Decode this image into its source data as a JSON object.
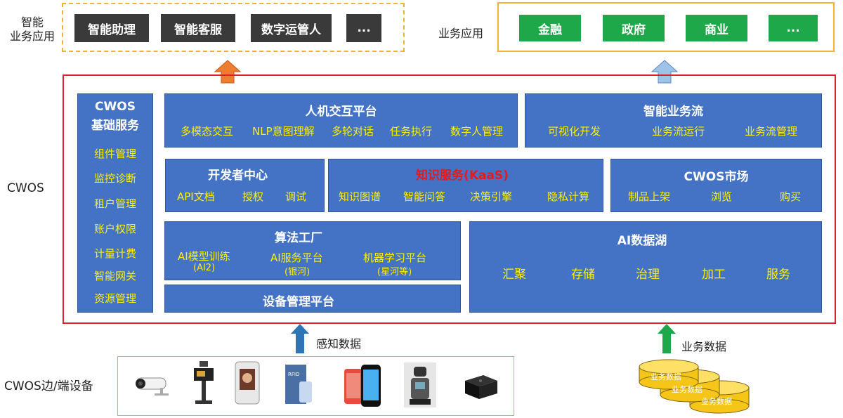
{
  "top_left": {
    "label_line1": "智能",
    "label_line2": "业务应用",
    "buttons": [
      "智能助理",
      "智能客服",
      "数字运管人",
      "..."
    ]
  },
  "top_right": {
    "label": "业务应用",
    "buttons": [
      "金融",
      "政府",
      "商业",
      "..."
    ]
  },
  "left_labels": {
    "cwos": "CWOS",
    "edge": "CWOS边/端设备"
  },
  "base_services": {
    "title_line1": "CWOS",
    "title_line2": "基础服务",
    "items": [
      "组件管理",
      "监控诊断",
      "租户管理",
      "账户权限",
      "计量计费",
      "智能网关",
      "资源管理"
    ]
  },
  "hci": {
    "title": "人机交互平台",
    "items": [
      "多模态交互",
      "NLP意图理解",
      "多轮对话",
      "任务执行",
      "数字人管理"
    ]
  },
  "workflow": {
    "title": "智能业务流",
    "items": [
      "可视化开发",
      "业务流运行",
      "业务流管理"
    ]
  },
  "dev_center": {
    "title": "开发者中心",
    "items": [
      "API文档",
      "授权",
      "调试"
    ]
  },
  "kaas": {
    "title": "知识服务(KaaS)",
    "items": [
      "知识图谱",
      "智能问答",
      "决策引擎",
      "隐私计算"
    ]
  },
  "market": {
    "title": "CWOS市场",
    "items": [
      "制品上架",
      "浏览",
      "购买"
    ]
  },
  "algo": {
    "title": "算法工厂",
    "items": [
      {
        "name": "AI模型训练",
        "sub": "(AI2)"
      },
      {
        "name": "AI服务平台",
        "sub": "(银河)"
      },
      {
        "name": "机器学习平台",
        "sub": "(星河等)"
      }
    ]
  },
  "device_mgmt": {
    "title": "设备管理平台"
  },
  "datalake": {
    "title": "AI数据湖",
    "items": [
      "汇聚",
      "存储",
      "治理",
      "加工",
      "服务"
    ]
  },
  "arrows": {
    "sensing": "感知数据",
    "business": "业务数据"
  },
  "db_labels": [
    "业务数据",
    "业务数据",
    "业务数据"
  ],
  "device_icons": [
    "camera-icon",
    "gate-terminal-icon",
    "face-recognition-terminal-icon",
    "rfid-card-icon",
    "smartphone-icon",
    "robot-icon",
    "edge-box-icon"
  ],
  "colors": {
    "dark_button": "#3a3a3a",
    "green_button": "#1fa84a",
    "panel_blue": "#4472c4",
    "item_yellow": "#fff100",
    "kaas_title": "#e8191c",
    "frame_red": "#d9232d",
    "frame_orange": "#f2b233",
    "arrow_orange": "#ed7d31",
    "arrow_blue": "#8eaadb",
    "arrow_darkblue": "#2e75b6",
    "arrow_green": "#1fa84a",
    "device_border": "#8fc97c",
    "db_yellow": "#f5c518"
  }
}
